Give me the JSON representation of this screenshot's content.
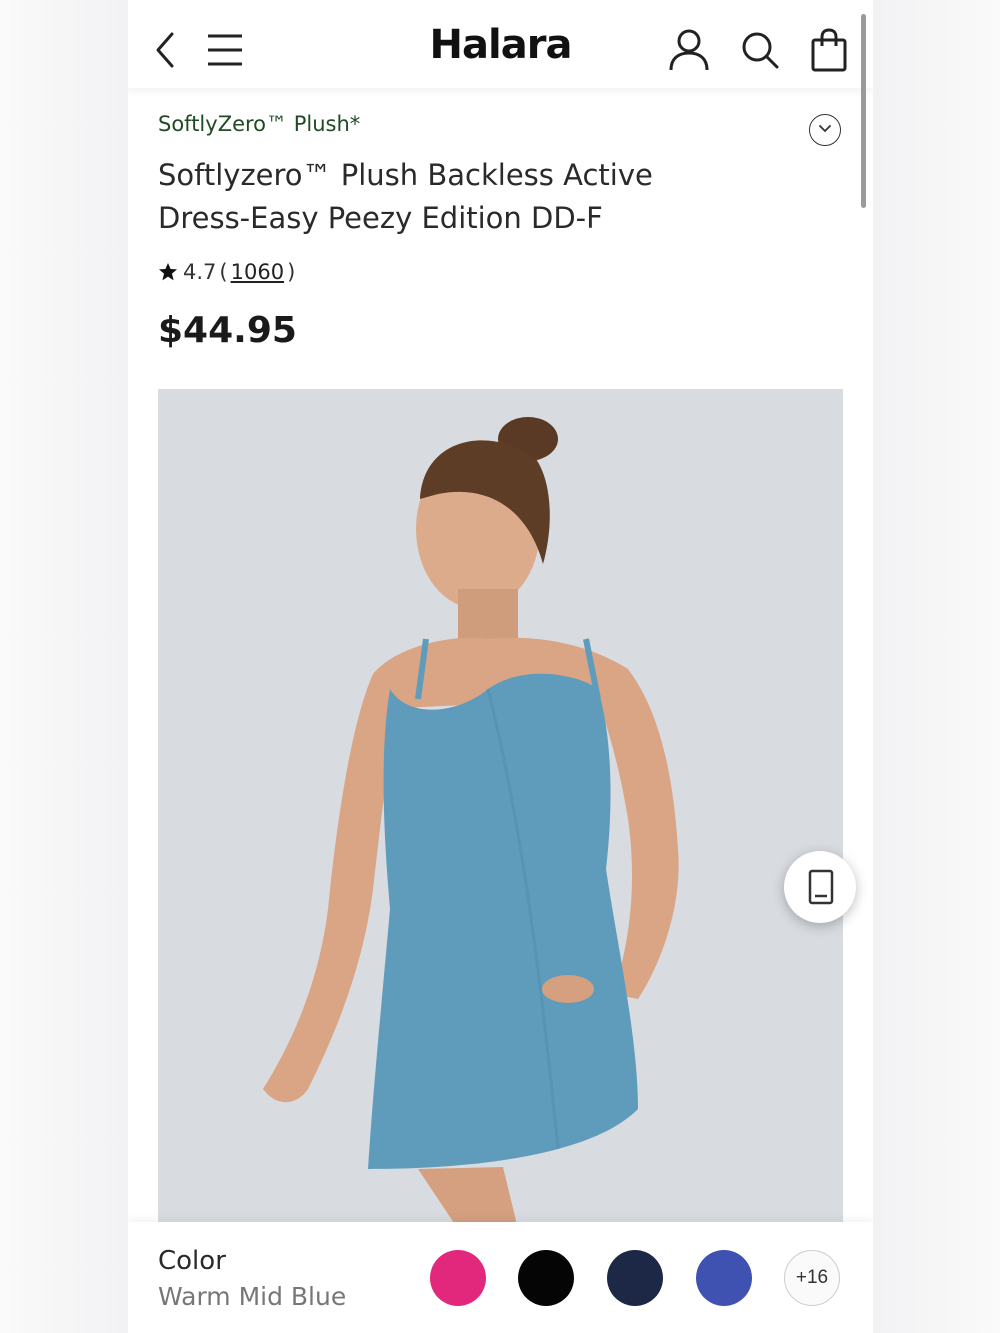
{
  "header": {
    "logo": "Halara",
    "icons": [
      "back-icon",
      "menu-icon",
      "account-icon",
      "search-icon",
      "bag-icon"
    ]
  },
  "product": {
    "brand": "SoftlyZero™ Plush*",
    "title_line1": "Softlyzero™ Plush Backless Active",
    "title_line2": "Dress-Easy Peezy Edition DD-F",
    "rating": "4.7",
    "review_count": "1060",
    "price": "$44.95",
    "image_description_icon": "product-photo"
  },
  "color_selector": {
    "label": "Color",
    "selected": "Warm Mid Blue",
    "swatches": [
      "#e2287d",
      "#050505",
      "#1d2847",
      "#3f52b2"
    ],
    "more": "+16"
  },
  "colors": {
    "brand_green": "#1f4a23",
    "image_bg": "#d8dbe0",
    "dress_blue": "#5f9cbc"
  }
}
